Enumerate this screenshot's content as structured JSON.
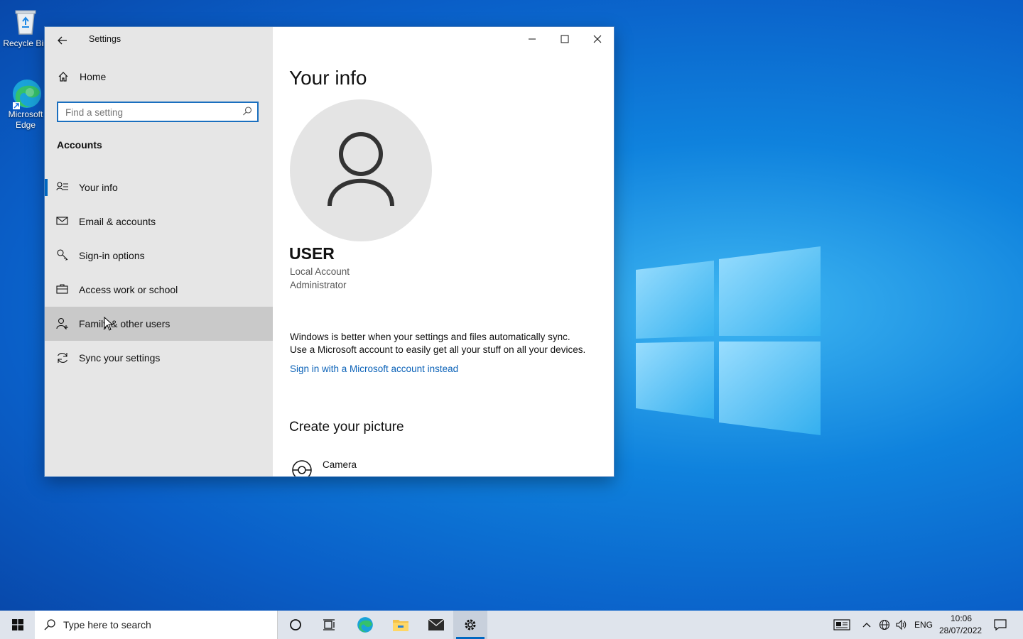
{
  "desktop": {
    "icons": [
      {
        "label": "Recycle Bin",
        "icon": "recycle-bin-icon"
      },
      {
        "label": "Microsoft Edge",
        "icon": "edge-icon"
      }
    ]
  },
  "window": {
    "title": "Settings",
    "controls": [
      "minimize-icon",
      "maximize-icon",
      "close-icon"
    ]
  },
  "sidebar": {
    "home_label": "Home",
    "search_placeholder": "Find a setting",
    "search_value": "",
    "section_label": "Accounts",
    "items": [
      {
        "label": "Your info",
        "icon": "user-info-icon",
        "selected": true
      },
      {
        "label": "Email & accounts",
        "icon": "mail-icon"
      },
      {
        "label": "Sign-in options",
        "icon": "key-icon"
      },
      {
        "label": "Access work or school",
        "icon": "briefcase-icon"
      },
      {
        "label": "Family & other users",
        "icon": "add-user-icon",
        "hover": true
      },
      {
        "label": "Sync your settings",
        "icon": "sync-icon"
      }
    ]
  },
  "content": {
    "title": "Your info",
    "user_name": "USER",
    "account_type": "Local Account",
    "role": "Administrator",
    "sync_line1": "Windows is better when your settings and files automatically sync.",
    "sync_line2": "Use a Microsoft account to easily get all your stuff on all your devices.",
    "ms_link": "Sign in with a Microsoft account instead",
    "picture_title": "Create your picture",
    "camera_label": "Camera"
  },
  "taskbar": {
    "search_placeholder": "Type here to search",
    "language": "ENG",
    "time": "10:06",
    "date": "28/07/2022",
    "accent": "#0067c0"
  }
}
